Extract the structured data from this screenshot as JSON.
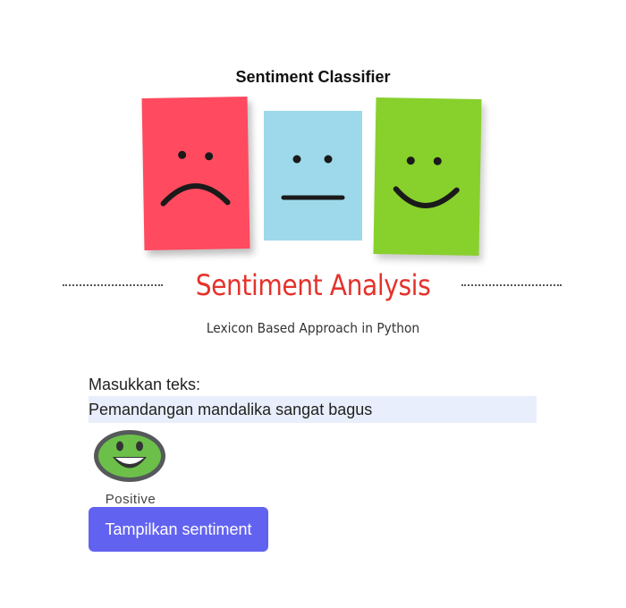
{
  "page": {
    "title": "Sentiment Classifier"
  },
  "banner": {
    "title": "Sentiment Analysis",
    "subtitle": "Lexicon Based Approach in Python",
    "faces": [
      "sad-face-icon",
      "neutral-face-icon",
      "happy-face-icon"
    ],
    "colors": {
      "sad": "#ff4a5f",
      "neutral": "#9dd9ea",
      "happy": "#88d02c",
      "title": "#e5322c"
    }
  },
  "form": {
    "label": "Masukkan teks:",
    "value": "Pemandangan mandalika sangat bagus",
    "button_label": "Tampilkan sentiment"
  },
  "result": {
    "icon": "smiley-face-icon",
    "label": "Positive"
  },
  "colors": {
    "button": "#6262f0",
    "input_bg": "#e8eefb"
  }
}
